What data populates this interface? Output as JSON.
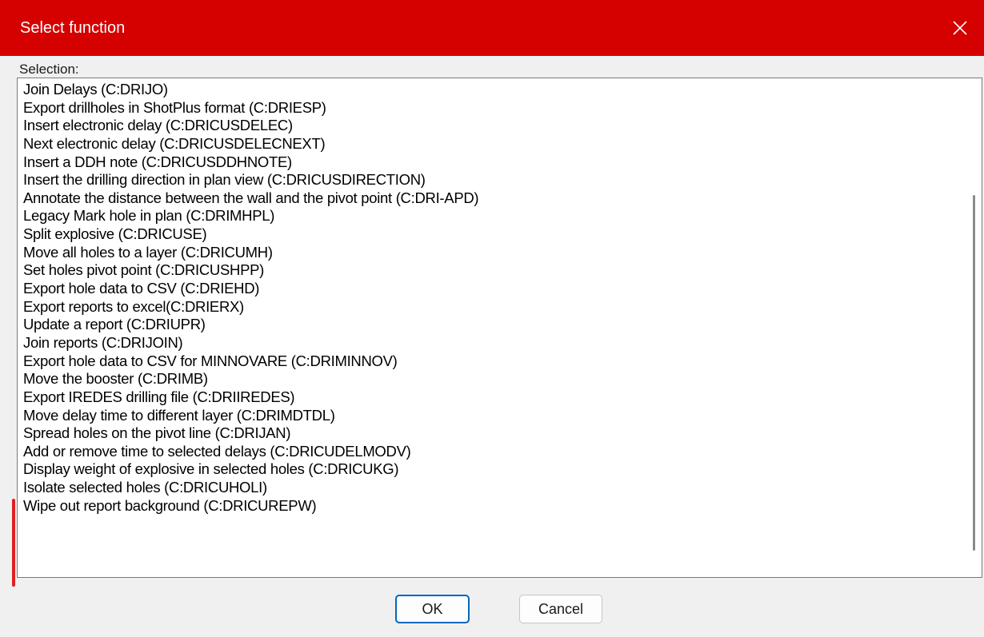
{
  "window": {
    "title": "Select function",
    "accent_color": "#d50000",
    "close_icon": "close-icon"
  },
  "selection": {
    "label": "Selection:",
    "items": [
      "Join Delays (C:DRIJO)",
      "Export drillholes in ShotPlus format (C:DRIESP)",
      "Insert electronic delay (C:DRICUSDELEC)",
      "Next electronic delay (C:DRICUSDELECNEXT)",
      "Insert a DDH note (C:DRICUSDDHNOTE)",
      "Insert the drilling direction in plan view (C:DRICUSDIRECTION)",
      "Annotate the distance between the wall and the pivot point (C:DRI-APD)",
      "Legacy Mark hole in plan (C:DRIMHPL)",
      "Split explosive (C:DRICUSE)",
      "Move all holes to a layer (C:DRICUMH)",
      "Set holes pivot point (C:DRICUSHPP)",
      "Export hole data to CSV (C:DRIEHD)",
      "Export reports to excel(C:DRIERX)",
      "Update a report (C:DRIUPR)",
      "Join reports (C:DRIJOIN)",
      "Export hole data to CSV for MINNOVARE (C:DRIMINNOV)",
      "Move the booster (C:DRIMB)",
      "Export IREDES drilling file (C:DRIIREDES)",
      "Move delay time to different layer (C:DRIMDTDL)",
      "Spread holes on the pivot line (C:DRIJAN)",
      "Add or remove time to selected delays (C:DRICUDELMODV)",
      "Display weight of explosive in selected holes (C:DRICUKG)",
      "Isolate selected holes (C:DRICUHOLI)",
      "Wipe out report background (C:DRICUREPW)"
    ]
  },
  "buttons": {
    "ok": "OK",
    "cancel": "Cancel"
  }
}
